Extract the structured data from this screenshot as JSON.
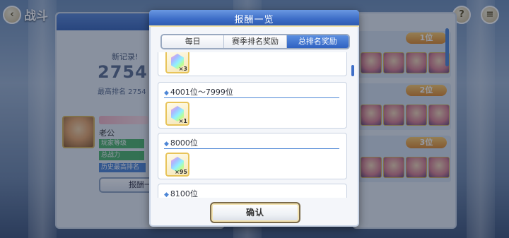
{
  "background": {
    "screen_title": "战斗",
    "new_record_label": "新记录!",
    "new_record_value": "2754",
    "best_rank_text": "最高排名 2754",
    "player_name": "老公",
    "stats": [
      "玩家等级",
      "总战力",
      "历史最高排名"
    ],
    "rewards_button": "报酬一",
    "rank_badges": [
      "1位",
      "2位",
      "3位"
    ],
    "help_icon_text": "?"
  },
  "modal": {
    "title": "报酬一览",
    "tabs": [
      {
        "label": "每日",
        "active": false
      },
      {
        "label": "赛季排名奖励",
        "active": false
      },
      {
        "label": "总排名奖励",
        "active": true
      }
    ],
    "rewards": [
      {
        "range": "",
        "item": "rainbow-crystal",
        "quantity": "×3"
      },
      {
        "range": "4001位〜7999位",
        "item": "rainbow-crystal",
        "quantity": "×1"
      },
      {
        "range": "8000位",
        "item": "rainbow-crystal",
        "quantity": "×95"
      },
      {
        "range": "8100位",
        "item": "rainbow-crystal",
        "quantity": ""
      }
    ],
    "confirm_label": "确认"
  },
  "colors": {
    "header_blue": "#3c6cc6",
    "active_tab": "#2f62c2",
    "accent_line": "#4d86d6",
    "item_border": "#e8c45a"
  }
}
